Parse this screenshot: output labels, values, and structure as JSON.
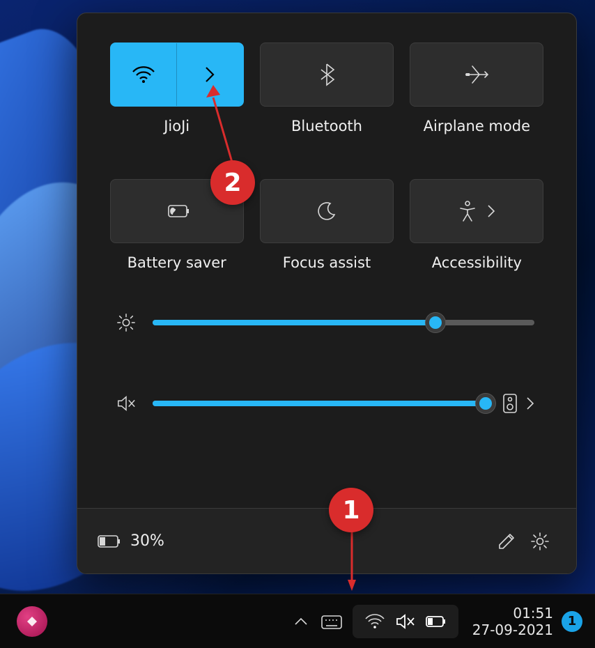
{
  "tiles": {
    "wifi_label": "JioJi",
    "bluetooth_label": "Bluetooth",
    "airplane_label": "Airplane mode",
    "battery_saver_label": "Battery saver",
    "focus_assist_label": "Focus assist",
    "accessibility_label": "Accessibility"
  },
  "sliders": {
    "brightness_pct": 74,
    "volume_pct": 100,
    "volume_muted": true
  },
  "footer": {
    "battery_pct_label": "30%"
  },
  "taskbar": {
    "time": "01:51",
    "date": "27-09-2021",
    "notification_count": "1"
  },
  "annotations": {
    "badge1": "1",
    "badge2": "2"
  },
  "colors": {
    "accent": "#28b7f6",
    "panel_bg": "#1c1c1c",
    "tile_bg": "#2d2d2d"
  }
}
